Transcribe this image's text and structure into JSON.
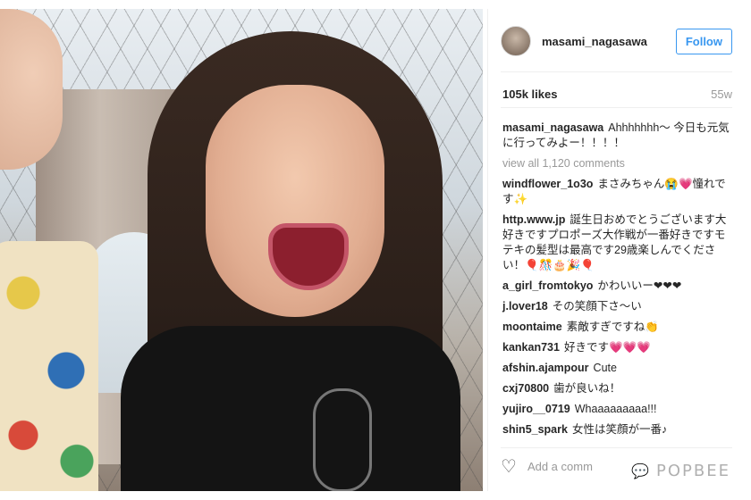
{
  "post": {
    "username": "masami_nagasawa",
    "follow_label": "Follow",
    "likes": "105k likes",
    "age": "55w",
    "caption_user": "masami_nagasawa",
    "caption_text": "Ahhhhhhh〜 今日も元気に行ってみよー！！！！",
    "view_all": "view all 1,120 comments",
    "add_comment_placeholder": "Add a comm",
    "watermark": "POPBEE"
  },
  "comments": [
    {
      "user": "windflower_1o3o",
      "text": "まさみちゃん😭💗憧れです✨"
    },
    {
      "user": "http.www.jp",
      "text": "誕生日おめでとうございます大好きですプロポーズ大作戦が一番好きですモテキの髪型は最高です29歳楽しんでください！🎈🎊🎂🎉🎈"
    },
    {
      "user": "a_girl_fromtokyo",
      "text": "かわいいー❤❤❤"
    },
    {
      "user": "j.lover18",
      "text": "その笑顔下さ〜い"
    },
    {
      "user": "moontaime",
      "text": "素敵すぎですね👏"
    },
    {
      "user": "kankan731",
      "text": "好きです💗💗💗"
    },
    {
      "user": "afshin.ajampour",
      "text": "Cute"
    },
    {
      "user": "cxj70800",
      "text": "歯が良いね！"
    },
    {
      "user": "yujiro__0719",
      "text": "Whaaaaaaaaa!!!"
    },
    {
      "user": "shin5_spark",
      "text": "女性は笑顔が一番♪"
    }
  ],
  "colors": {
    "accent": "#3897f0"
  }
}
